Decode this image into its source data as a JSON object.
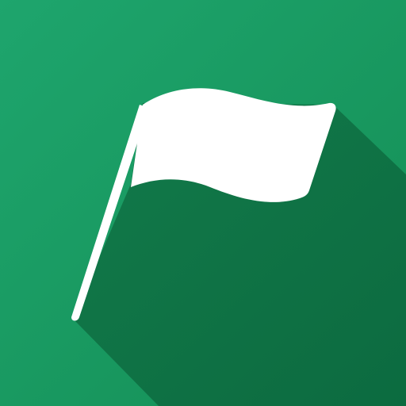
{
  "icon": {
    "name": "flag-icon",
    "colors": {
      "background_top": "#1EA56D",
      "background_bottom": "#148E55",
      "shadow_start": "#127A4A",
      "shadow_end": "#0C6B40",
      "flag": "#FFFFFF"
    }
  }
}
